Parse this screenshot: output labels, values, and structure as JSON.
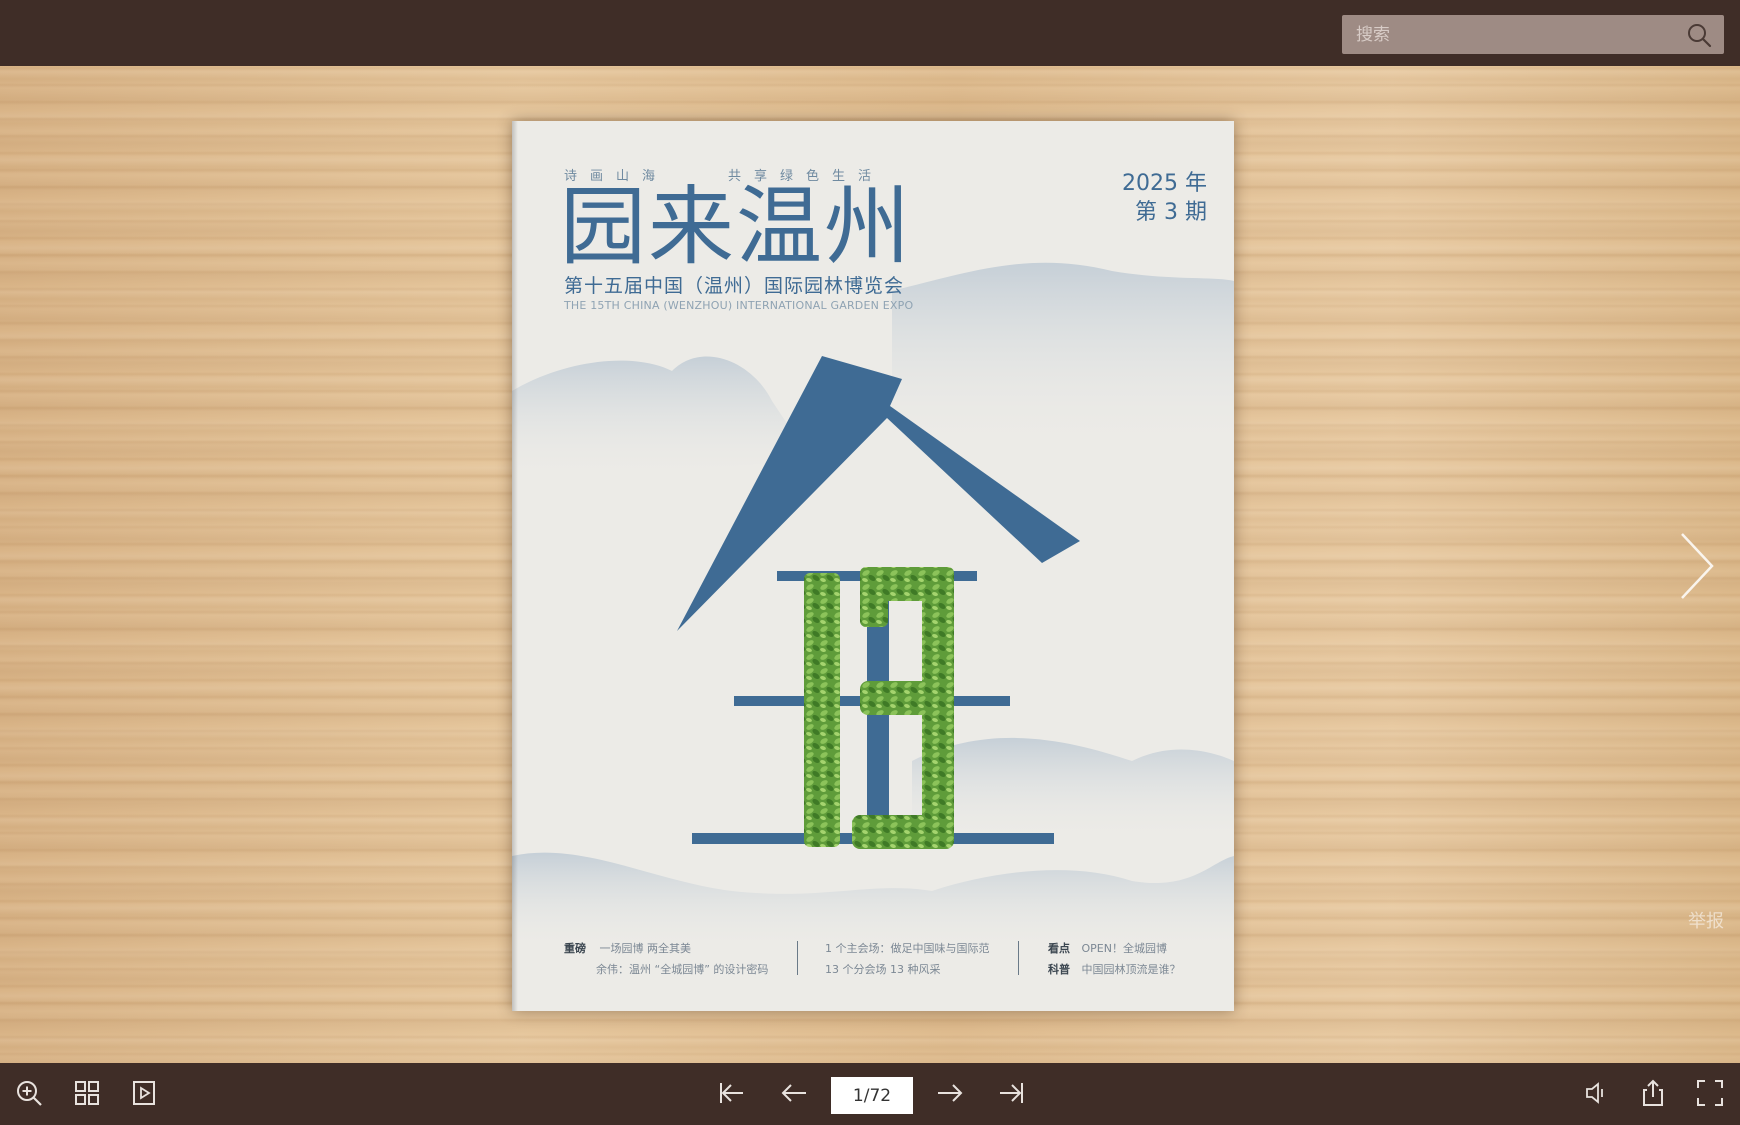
{
  "search": {
    "placeholder": "搜索"
  },
  "page": {
    "slogan_left": "诗画山海",
    "slogan_right": "共享绿色生活",
    "title": "园来温州",
    "subtitle_cn": "第十五届中国（温州）国际园林博览会",
    "subtitle_en": "THE 15TH CHINA (WENZHOU) INTERNATIONAL GARDEN EXPO",
    "issue_year": "2025 年",
    "issue_number": "第 3 期",
    "footer": {
      "col1_label": "重磅",
      "col1_line1": "一场园博  两全其美",
      "col1_line2": "余伟：温州 “全城园博” 的设计密码",
      "col2_line1": "1 个主会场：做足中国味与国际范",
      "col2_line2": "13 个分会场 13 种风采",
      "col3_label1": "看点",
      "col3_line1": "OPEN！全城园博",
      "col3_label2": "科普",
      "col3_line2": "中国园林顶流是谁？"
    }
  },
  "report_label": "举报",
  "pager": {
    "current": "1/72"
  },
  "colors": {
    "chrome": "#3f2d27",
    "accent_blue": "#3f6b94",
    "leaf_green": "#5f9c3a"
  },
  "icons": [
    "search-icon",
    "zoom-in-icon",
    "thumbnails-icon",
    "autoplay-icon",
    "first-page-icon",
    "prev-page-icon",
    "next-page-icon",
    "last-page-icon",
    "sound-icon",
    "share-icon",
    "fullscreen-icon",
    "chevron-right-icon"
  ]
}
